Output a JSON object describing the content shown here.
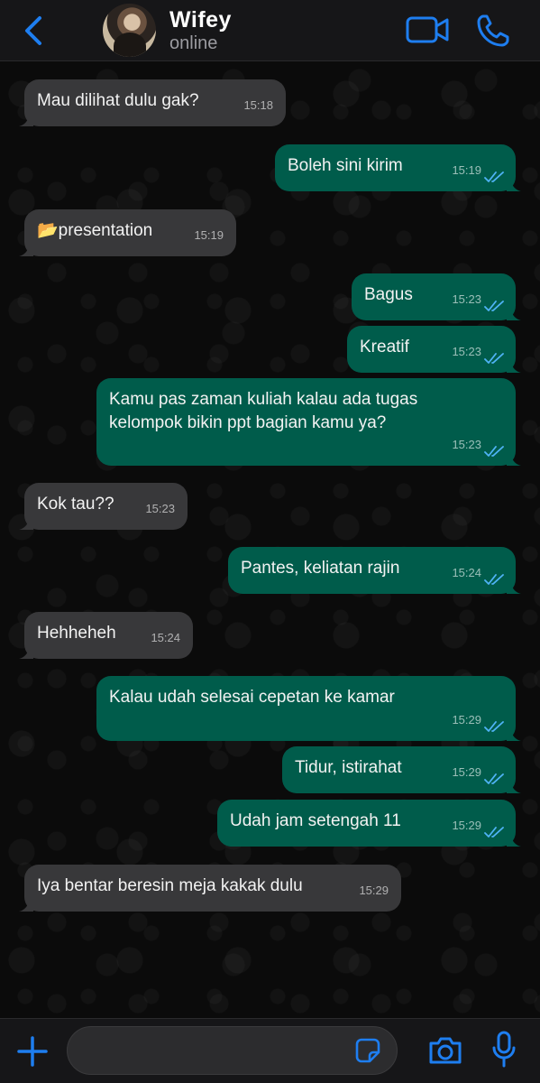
{
  "colors": {
    "accent": "#1e7ef0",
    "incoming_bubble": "#38383a",
    "outgoing_bubble": "#005c4b",
    "read_ticks": "#4fb3f6"
  },
  "header": {
    "contact_name": "Wifey",
    "status": "online",
    "icons": [
      "back-chevron-icon",
      "avatar",
      "video-camera-icon",
      "phone-icon"
    ]
  },
  "messages": [
    {
      "dir": "in",
      "text": "Mau dilihat dulu gak?",
      "time": "15:18"
    },
    {
      "dir": "out",
      "text": "Boleh sini kirim",
      "time": "15:19",
      "status": "read"
    },
    {
      "dir": "in",
      "text": "📂presentation",
      "time": "15:19"
    },
    {
      "dir": "out",
      "text": "Bagus",
      "time": "15:23",
      "status": "read"
    },
    {
      "dir": "out",
      "text": "Kreatif",
      "time": "15:23",
      "status": "read"
    },
    {
      "dir": "out",
      "text": "Kamu pas zaman kuliah kalau ada tugas\nkelompok bikin ppt bagian kamu ya?",
      "time": "15:23",
      "status": "read"
    },
    {
      "dir": "in",
      "text": "Kok tau??",
      "time": "15:23"
    },
    {
      "dir": "out",
      "text": "Pantes, keliatan rajin",
      "time": "15:24",
      "status": "read"
    },
    {
      "dir": "in",
      "text": "Hehheheh",
      "time": "15:24"
    },
    {
      "dir": "out",
      "text": "Kalau udah selesai cepetan ke kamar",
      "time": "15:29",
      "status": "read"
    },
    {
      "dir": "out",
      "text": "Tidur, istirahat",
      "time": "15:29",
      "status": "read"
    },
    {
      "dir": "out",
      "text": "Udah jam setengah 11",
      "time": "15:29",
      "status": "read"
    },
    {
      "dir": "in",
      "text": "Iya bentar beresin meja kakak dulu",
      "time": "15:29"
    }
  ],
  "footer": {
    "input_value": "",
    "icons": [
      "plus-icon",
      "sticker-icon",
      "camera-icon",
      "microphone-icon"
    ]
  }
}
